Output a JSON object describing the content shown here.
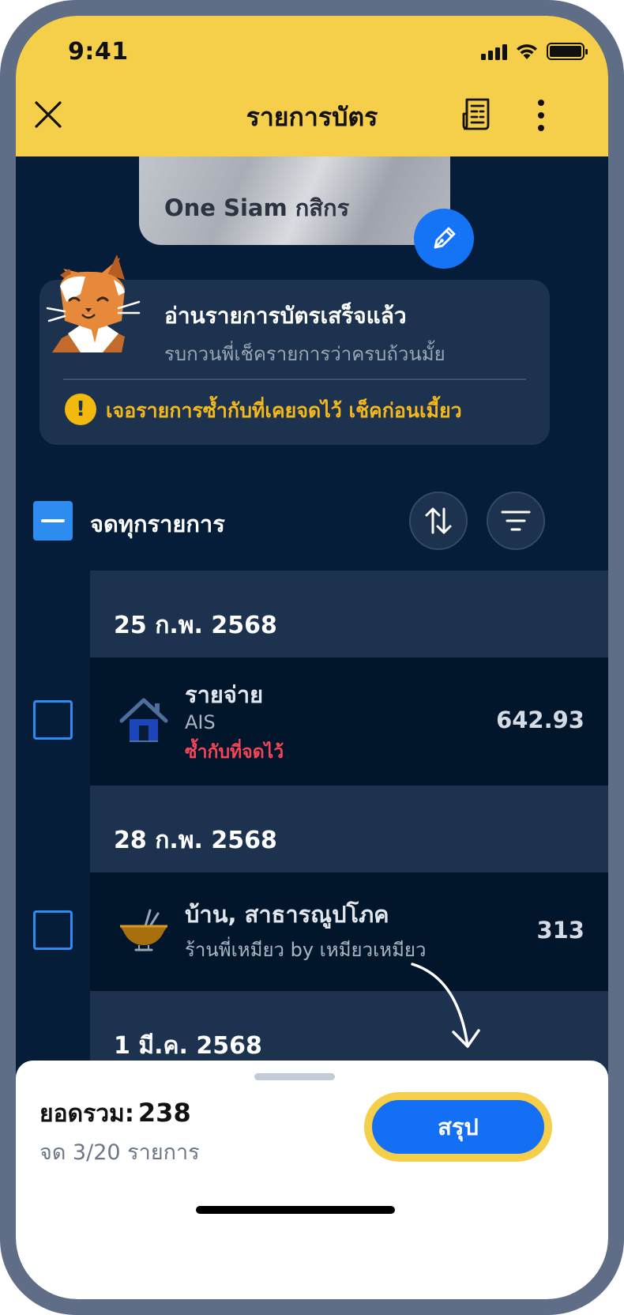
{
  "status_bar": {
    "time": "9:41"
  },
  "header": {
    "title": "รายการบัตร",
    "icons": [
      "close-icon",
      "receipt-icon",
      "more-vertical-icon"
    ]
  },
  "card": {
    "name": "One Siam กสิกร",
    "edit_icon": "pen-icon"
  },
  "notice": {
    "title": "อ่านรายการบัตรเสร็จแล้ว",
    "subtitle": "รบกวนพี่เช็ครายการว่าครบถ้วนมั้ย",
    "warning": "เจอรายการซ้ำกับที่เคยจดไว้ เช็คก่อนเมี้ยว"
  },
  "controls": {
    "select_all_label": "จดทุกรายการ",
    "sort_icon": "sort-icon",
    "filter_icon": "filter-icon"
  },
  "groups": [
    {
      "date": "25 ก.พ. 2568",
      "items": [
        {
          "category": "รายจ่าย",
          "merchant": "AIS",
          "amount": "642.93",
          "duplicate_label": "ซ้ำกับที่จดไว้",
          "icon": "house-icon",
          "checked": false
        }
      ]
    },
    {
      "date": "28 ก.พ. 2568",
      "items": [
        {
          "category": "บ้าน, สาธารณูปโภค",
          "merchant": "ร้านพี่เหมียว by เหมียวเหมียว",
          "amount": "313",
          "icon": "noodle-bowl-icon",
          "checked": false
        }
      ]
    },
    {
      "date": "1 มี.ค. 2568",
      "items": []
    }
  ],
  "summary": {
    "total_label": "ยอดรวม:",
    "total_value": "238",
    "recorded_text": "จด 3/20 รายการ",
    "button_label": "สรุป"
  },
  "colors": {
    "header_bg": "#f6cf4a",
    "screen_bg": "#051d38",
    "accent_blue": "#136ff4",
    "warning_yellow": "#f3b81c",
    "duplicate_red": "#f04655"
  }
}
